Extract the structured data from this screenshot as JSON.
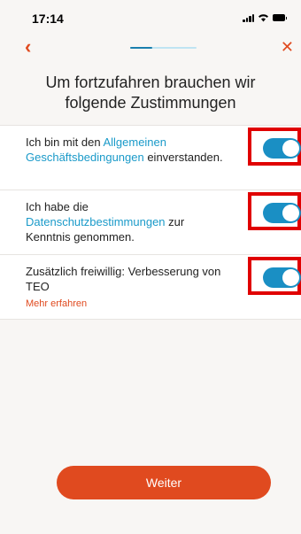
{
  "status": {
    "time": "17:14"
  },
  "nav": {
    "back_icon": "chevron-left-icon",
    "close_icon": "close-icon",
    "progress": 0.33
  },
  "headline": "Um fortzufahren brauchen wir folgende Zustimmungen",
  "consents": [
    {
      "before": "Ich bin mit den ",
      "link": "Allgemeinen Geschäftsbedingungen",
      "after": " einverstanden.",
      "enabled": true
    },
    {
      "before": "Ich habe die ",
      "link": "Datenschutzbestimmungen",
      "after": " zur Kenntnis genommen.",
      "enabled": true
    },
    {
      "before": "Zusätzlich freiwillig: Verbesserung von TEO",
      "more": "Mehr erfahren",
      "enabled": true
    }
  ],
  "buttons": {
    "continue_label": "Weiter"
  },
  "colors": {
    "accent": "#e04a1f",
    "link": "#1a9ac9",
    "toggle_on": "#1a8fc4",
    "highlight": "#e00000"
  }
}
